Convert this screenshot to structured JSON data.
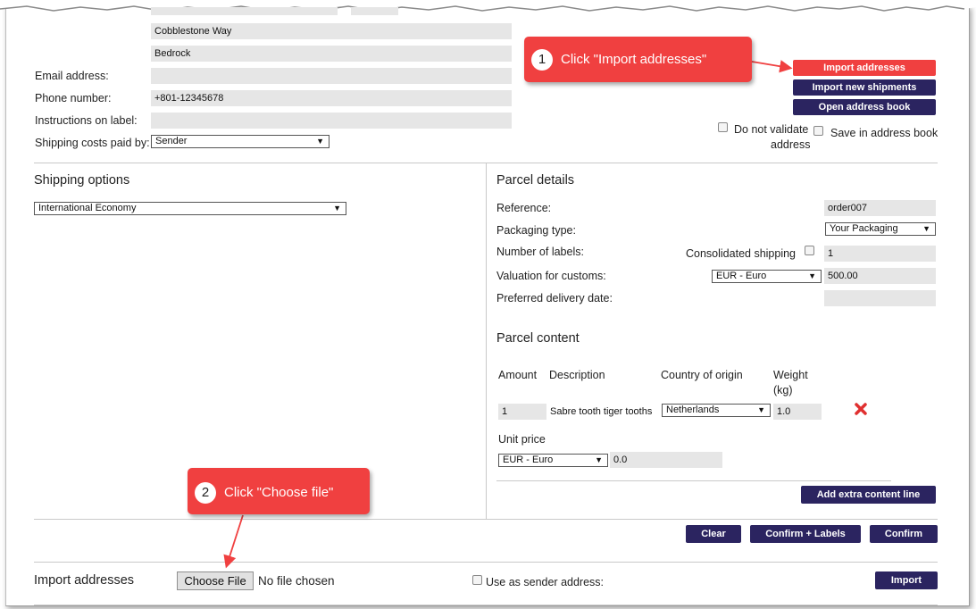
{
  "address": {
    "street": "Cobblestone Way",
    "city": "Bedrock",
    "email_label": "Email address:",
    "email_value": "",
    "phone_label": "Phone number:",
    "phone_value": "+801-12345678",
    "instructions_label": "Instructions on label:",
    "instructions_value": "",
    "shipping_paid_label": "Shipping costs paid by:",
    "shipping_paid_value": "Sender"
  },
  "top_buttons": {
    "import_addresses": "Import addresses",
    "import_new_shipments": "Import new shipments",
    "open_address_book": "Open address book"
  },
  "options": {
    "do_not_validate_1": "Do not validate",
    "do_not_validate_2": "address",
    "save_in_address_book": "Save in address book"
  },
  "shipping_options": {
    "heading": "Shipping options",
    "service": "International Economy"
  },
  "parcel_details": {
    "heading": "Parcel details",
    "reference_label": "Reference:",
    "reference_value": "order007",
    "packaging_label": "Packaging type:",
    "packaging_value": "Your Packaging",
    "labels_label": "Number of labels:",
    "consolidated_label": "Consolidated shipping",
    "labels_value": "1",
    "valuation_label": "Valuation for customs:",
    "valuation_currency": "EUR - Euro",
    "valuation_value": "500.00",
    "delivery_date_label": "Preferred delivery date:",
    "delivery_date_value": ""
  },
  "parcel_content": {
    "heading": "Parcel content",
    "col_amount": "Amount",
    "col_description": "Description",
    "col_country": "Country of origin",
    "col_weight_1": "Weight",
    "col_weight_2": "(kg)",
    "row": {
      "amount": "1",
      "description": "Sabre tooth tiger tooths",
      "country": "Netherlands",
      "weight": "1.0"
    },
    "unit_price_label": "Unit price",
    "unit_price_currency": "EUR - Euro",
    "unit_price_value": "0.0",
    "add_line_button": "Add extra content line"
  },
  "actions": {
    "clear": "Clear",
    "confirm_labels": "Confirm + Labels",
    "confirm": "Confirm"
  },
  "import_section": {
    "heading": "Import addresses",
    "choose_file": "Choose File",
    "no_file": "No file chosen",
    "use_as_sender": "Use as sender address:",
    "import_button": "Import"
  },
  "callouts": {
    "step1_number": "1",
    "step1_text": "Click \"Import addresses\"",
    "step2_number": "2",
    "step2_text": "Click \"Choose file\""
  },
  "colors": {
    "button": "#2b2460",
    "highlight": "#f04040",
    "field": "#e6e6e6"
  }
}
